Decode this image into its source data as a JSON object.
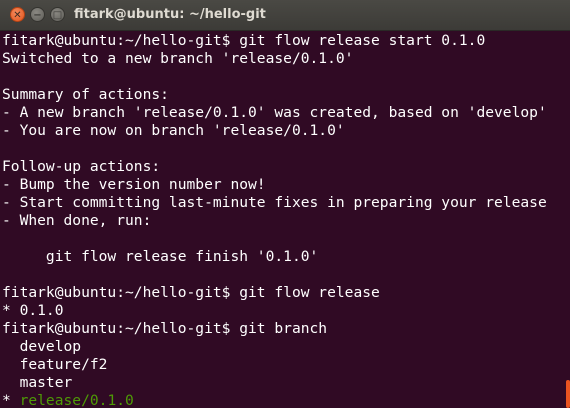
{
  "window": {
    "title": "fitark@ubuntu: ~/hello-git",
    "close_glyph": "✕",
    "minimize_glyph": "−",
    "maximize_glyph": "□"
  },
  "terminal": {
    "lines": [
      "fitark@ubuntu:~/hello-git$ git flow release start 0.1.0",
      "Switched to a new branch 'release/0.1.0'",
      "",
      "Summary of actions:",
      "- A new branch 'release/0.1.0' was created, based on 'develop'",
      "- You are now on branch 'release/0.1.0'",
      "",
      "Follow-up actions:",
      "- Bump the version number now!",
      "- Start committing last-minute fixes in preparing your release",
      "- When done, run:",
      "",
      "     git flow release finish '0.1.0'",
      "",
      "fitark@ubuntu:~/hello-git$ git flow release",
      "* 0.1.0",
      "fitark@ubuntu:~/hello-git$ git branch",
      "  develop",
      "  feature/f2",
      "  master"
    ],
    "current_branch_marker": "* ",
    "current_branch": "release/0.1.0"
  },
  "colors": {
    "background": "#300a24",
    "text": "#ffffff",
    "current_branch": "#4e9a06",
    "titlebar": "#3c3b37",
    "close_button": "#e0541d",
    "scrollbar": "#e95420"
  }
}
